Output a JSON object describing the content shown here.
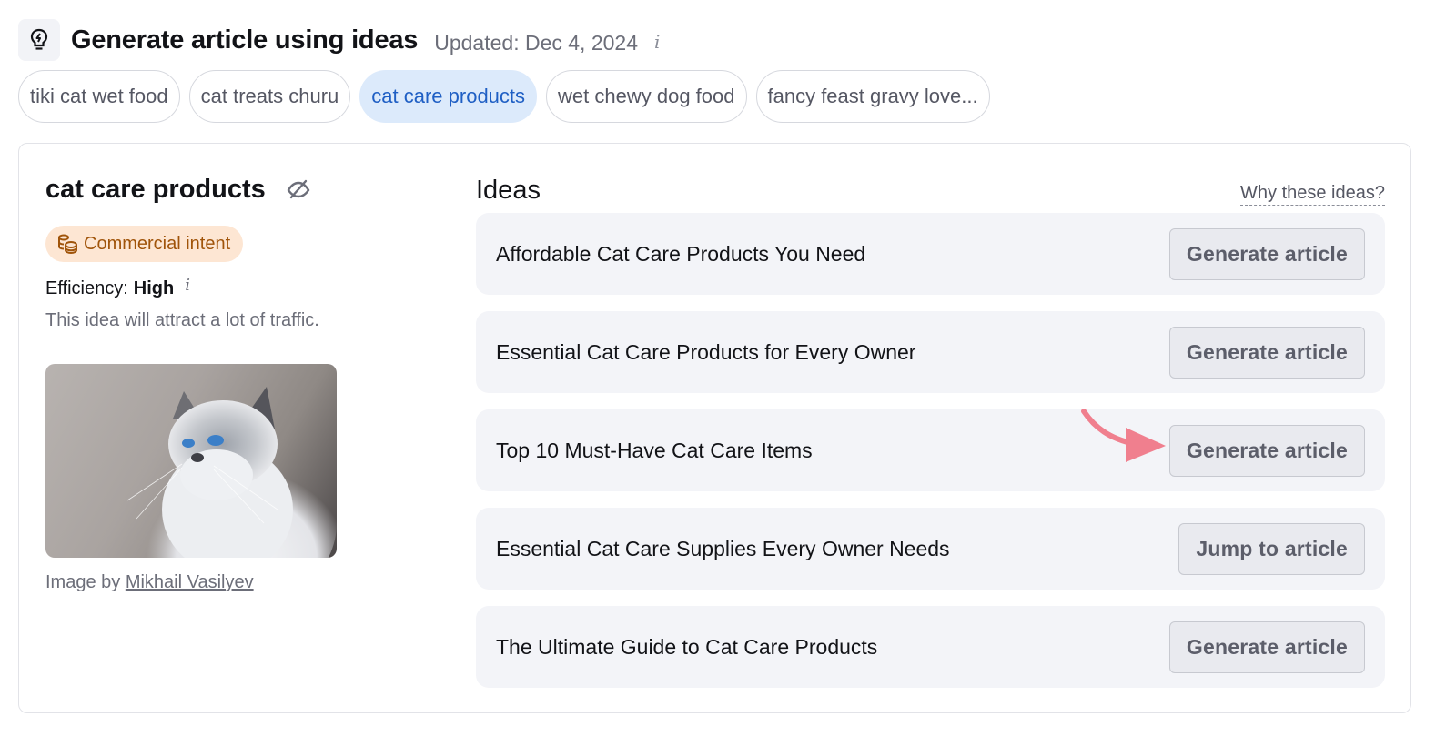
{
  "header": {
    "icon": "lightbulb-bolt-icon",
    "title": "Generate article using ideas",
    "updated": "Updated: Dec 4, 2024",
    "info_glyph": "i"
  },
  "keyword_chips": [
    {
      "label": "tiki cat wet food",
      "active": false
    },
    {
      "label": "cat treats churu",
      "active": false
    },
    {
      "label": "cat care products",
      "active": true
    },
    {
      "label": "wet chewy dog food",
      "active": false
    },
    {
      "label": "fancy feast gravy love...",
      "active": false
    }
  ],
  "keyword_panel": {
    "title": "cat care products",
    "hide_icon": "eye-off-icon",
    "intent": {
      "label": "Commercial intent",
      "icon": "coins-icon",
      "color": "#a0540a",
      "bg": "#fde6d3"
    },
    "efficiency_label": "Efficiency:",
    "efficiency_value": "High",
    "efficiency_info": "i",
    "efficiency_desc": "This idea will attract a lot of traffic.",
    "image_alt": "White cat with blue eyes looking up",
    "credit_prefix": "Image by",
    "credit_author": "Mikhail Vasilyev"
  },
  "ideas": {
    "title": "Ideas",
    "why_link": "Why these ideas?",
    "items": [
      {
        "text": "Affordable Cat Care Products You Need",
        "button": "Generate article"
      },
      {
        "text": "Essential Cat Care Products for Every Owner",
        "button": "Generate article"
      },
      {
        "text": "Top 10 Must-Have Cat Care Items",
        "button": "Generate article"
      },
      {
        "text": "Essential Cat Care Supplies Every Owner Needs",
        "button": "Jump to article"
      },
      {
        "text": "The Ultimate Guide to Cat Care Products",
        "button": "Generate article"
      }
    ]
  },
  "annotation": {
    "type": "arrow",
    "color": "#f07f8e",
    "points_to": "ideas.items.2.button"
  }
}
